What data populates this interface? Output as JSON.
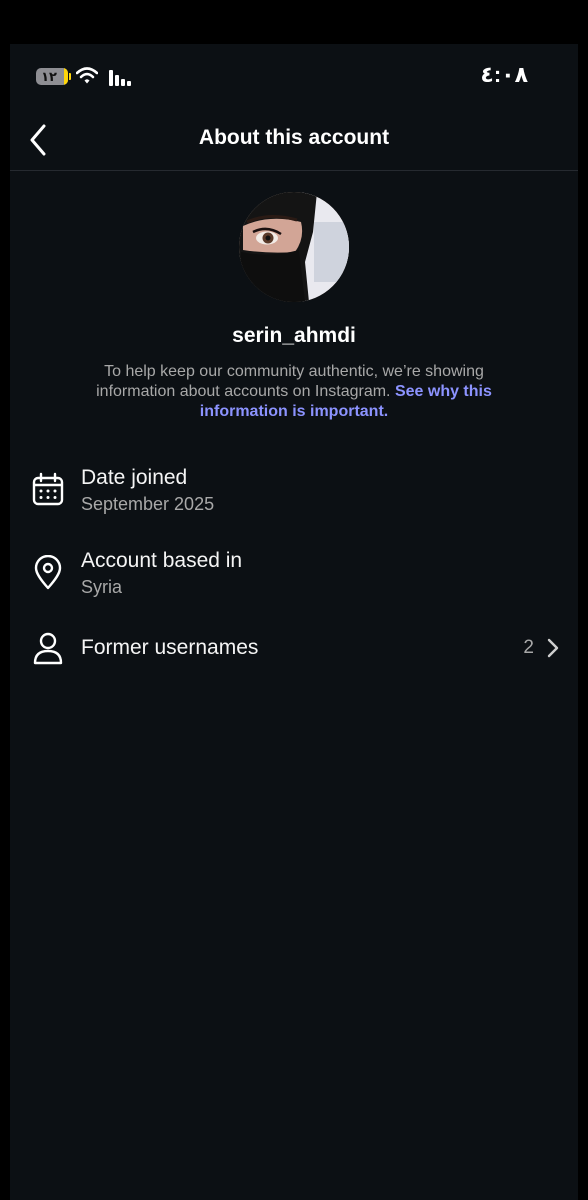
{
  "status_bar": {
    "battery": "١٢",
    "time": "٤:٠٨"
  },
  "header": {
    "title": "About this account"
  },
  "profile": {
    "username": "serin_ahmdi",
    "info_text": "To help keep our community authentic, we’re showing information about accounts on Instagram. ",
    "info_link": "See why this information is important."
  },
  "rows": [
    {
      "title": "Date joined",
      "subtitle": "September 2025",
      "icon": "calendar-icon"
    },
    {
      "title": "Account based in",
      "subtitle": "Syria",
      "icon": "location-pin-icon"
    },
    {
      "title": "Former usernames",
      "count": "2",
      "icon": "person-icon"
    }
  ],
  "colors": {
    "background": "#0c1014",
    "link": "#8c93ff",
    "text_primary": "#f5f5f5",
    "text_secondary": "#a8a8a8"
  }
}
